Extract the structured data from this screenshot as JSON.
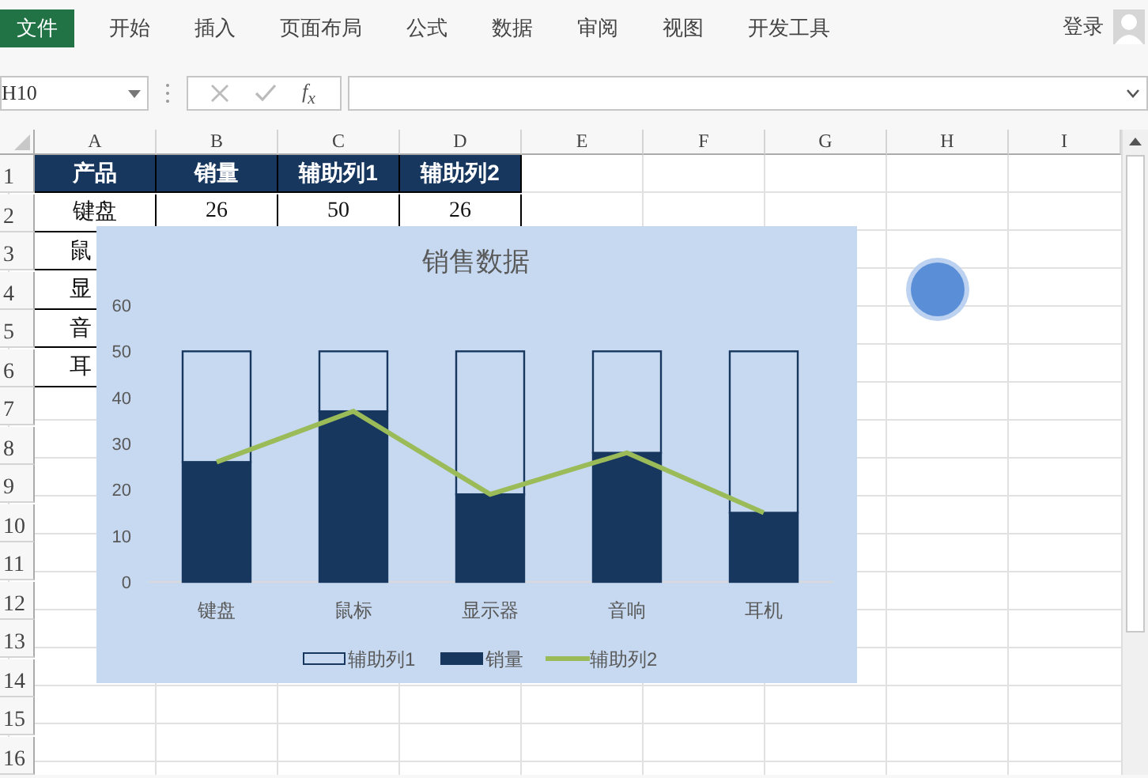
{
  "ribbon": {
    "tabs": [
      {
        "label": "文件",
        "kind": "file"
      },
      {
        "label": "开始",
        "kind": "tab"
      },
      {
        "label": "插入",
        "kind": "tab"
      },
      {
        "label": "页面布局",
        "kind": "tab"
      },
      {
        "label": "公式",
        "kind": "tab"
      },
      {
        "label": "数据",
        "kind": "tab"
      },
      {
        "label": "审阅",
        "kind": "tab"
      },
      {
        "label": "视图",
        "kind": "tab"
      },
      {
        "label": "开发工具",
        "kind": "tab"
      }
    ],
    "sign_in": "登录"
  },
  "formula_bar": {
    "name_box": "H10",
    "function_label": "f$_{x}$"
  },
  "sheet": {
    "columns": [
      "A",
      "B",
      "C",
      "D",
      "E",
      "F",
      "G",
      "H",
      "I"
    ],
    "rows": [
      "1",
      "2",
      "3",
      "4",
      "5",
      "6",
      "7",
      "8",
      "9",
      "10",
      "11",
      "12",
      "13",
      "14",
      "15",
      "16"
    ],
    "table": {
      "header": [
        "产品",
        "销量",
        "辅助列1",
        "辅助列2"
      ],
      "rows": [
        [
          "键盘",
          "26",
          "50",
          "26"
        ],
        [
          "鼠"
        ],
        [
          "显"
        ],
        [
          "音"
        ],
        [
          "耳"
        ]
      ]
    }
  },
  "chart": {
    "chart_data": {
      "type": "bar",
      "title": "销售数据",
      "categories": [
        "键盘",
        "鼠标",
        "显示器",
        "音响",
        "耳机"
      ],
      "stacked": true,
      "legend": "bottom",
      "series": [
        {
          "name": "辅助列1",
          "type": "bar",
          "color": "#c6d9f1",
          "values": [
            24,
            13,
            31,
            22,
            35
          ]
        },
        {
          "name": "销量",
          "type": "bar",
          "color": "#17375e",
          "values": [
            26,
            37,
            19,
            28,
            15
          ]
        },
        {
          "name": "辅助列2",
          "type": "line",
          "color": "#9bbb59",
          "values": [
            26,
            37,
            19,
            28,
            15
          ]
        }
      ],
      "ylim": [
        0,
        60
      ],
      "yticks": [
        0,
        10,
        20,
        30,
        40,
        50,
        60
      ]
    }
  }
}
